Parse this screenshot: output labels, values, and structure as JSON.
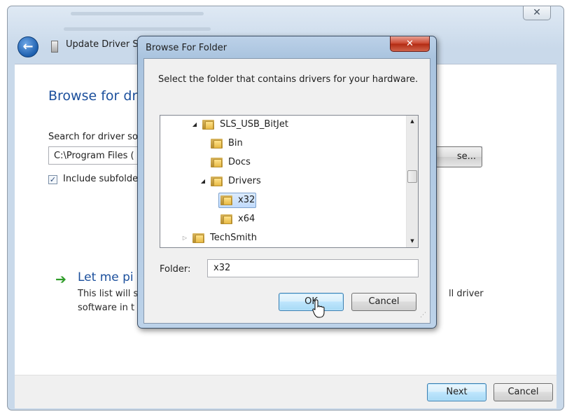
{
  "main_window": {
    "title": "Update Driver S",
    "close_glyph": "✕",
    "back_glyph": "←",
    "heading": "Browse for dri",
    "search_label": "Search for driver so",
    "path_value": "C:\\Program Files (",
    "browse_button": "se...",
    "include_subfolders": {
      "label": "Include subfolde",
      "checked": true,
      "check_glyph": "✓"
    },
    "let_me_pick": {
      "arrow_glyph": "➔",
      "title": "Let me pi",
      "desc_line1": "This list will s",
      "desc_line2": "software in t",
      "desc_right": "ll driver"
    },
    "footer": {
      "next_button": "Next",
      "cancel_button": "Cancel"
    }
  },
  "dialog": {
    "title": "Browse For Folder",
    "close_glyph": "✕",
    "instruction": "Select the folder that contains drivers for your hardware.",
    "tree": [
      {
        "label": "SLS_USB_BitJet",
        "expander": "open",
        "selected": false
      },
      {
        "label": "Bin",
        "expander": "none",
        "selected": false
      },
      {
        "label": "Docs",
        "expander": "none",
        "selected": false
      },
      {
        "label": "Drivers",
        "expander": "open",
        "selected": false
      },
      {
        "label": "x32",
        "expander": "none",
        "selected": true
      },
      {
        "label": "x64",
        "expander": "none",
        "selected": false
      },
      {
        "label": "TechSmith",
        "expander": "closed",
        "selected": false
      }
    ],
    "folder_label": "Folder:",
    "folder_value": "x32",
    "ok_button": "OK",
    "cancel_button": "Cancel"
  },
  "colors": {
    "heading_blue": "#1b4f9c",
    "green_arrow": "#2f9c29",
    "close_red": "#c9442d"
  }
}
